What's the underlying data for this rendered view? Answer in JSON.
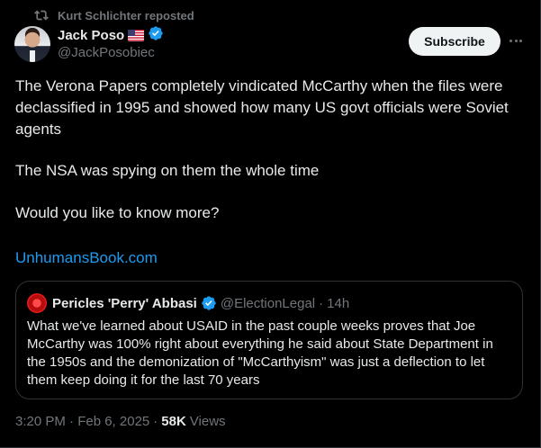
{
  "repost": {
    "label": "Kurt Schlichter reposted",
    "icon": "repost-icon"
  },
  "author": {
    "display_name": "Jack Poso",
    "flag_icon": "us-flag-icon",
    "verified_icon": "verified-badge-icon",
    "handle": "@JackPosobiec"
  },
  "actions": {
    "subscribe_label": "Subscribe",
    "more_icon": "more-options-icon"
  },
  "tweet": {
    "paragraph1": "The Verona Papers completely vindicated McCarthy when the files were declassified in 1995 and showed how many US govt officials were Soviet agents",
    "paragraph2": "The NSA was spying on them the whole time",
    "paragraph3": "Would you like to know more?",
    "link": "UnhumansBook.com"
  },
  "quote": {
    "name": "Pericles 'Perry' Abbasi",
    "verified_icon": "verified-badge-icon",
    "handle": "@ElectionLegal",
    "dot": "·",
    "time": "14h",
    "text": "What we've learned about USAID in the past couple weeks proves that Joe McCarthy was 100% right about everything he said about State Department in the 1950s and the demonization of \"McCarthyism\" was just a deflection to let them keep doing it for the last 70 years"
  },
  "meta": {
    "timestamp": "3:20 PM · Feb 6, 2025",
    "dot": "·",
    "views_count": "58K",
    "views_label": "Views"
  },
  "colors": {
    "background": "#000000",
    "text": "#e7e9ea",
    "secondary": "#71767b",
    "link": "#1d9bf0",
    "border": "#2f3336",
    "verified": "#1d9bf0"
  }
}
